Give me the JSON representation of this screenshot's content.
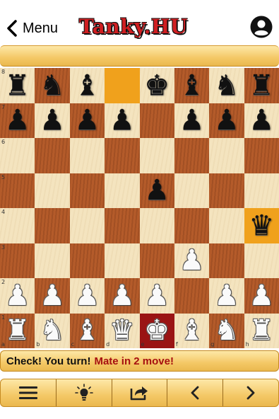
{
  "nav": {
    "back_label": "Menu",
    "logo_text": "Tanky.HU"
  },
  "board": {
    "files": [
      "a",
      "b",
      "c",
      "d",
      "e",
      "f",
      "g",
      "h"
    ],
    "ranks": [
      "8",
      "7",
      "6",
      "5",
      "4",
      "3",
      "2",
      "1"
    ],
    "position": [
      [
        "r",
        "n",
        "b",
        "",
        "k",
        "b",
        "n",
        "r"
      ],
      [
        "p",
        "p",
        "p",
        "p",
        "",
        "p",
        "p",
        "p"
      ],
      [
        "",
        "",
        "",
        "",
        "",
        "",
        "",
        ""
      ],
      [
        "",
        "",
        "",
        "",
        "p",
        "",
        "",
        ""
      ],
      [
        "",
        "",
        "",
        "",
        "",
        "",
        "",
        "q"
      ],
      [
        "",
        "",
        "",
        "",
        "",
        "P",
        "",
        ""
      ],
      [
        "P",
        "P",
        "P",
        "P",
        "P",
        "",
        "P",
        "P"
      ],
      [
        "R",
        "N",
        "B",
        "Q",
        "K",
        "B",
        "N",
        "R"
      ]
    ],
    "highlights": {
      "d8": "orange",
      "h4": "orange",
      "e1": "red"
    }
  },
  "status": {
    "text": "Check! You turn!",
    "mate_text": "Mate in 2 move!"
  },
  "toolbar": {
    "buttons": [
      "menu-icon",
      "hint-lightbulb-icon",
      "share-icon",
      "previous-move-icon",
      "next-move-icon"
    ]
  },
  "colors": {
    "logo_red": "#cf1f22",
    "light_square": "#f4e4bf",
    "dark_square": "#b45b2a",
    "highlight_orange": "#f0a11c",
    "highlight_red": "#9a1414",
    "mate_text": "#a61010",
    "bar_gold": "#f4c866"
  }
}
